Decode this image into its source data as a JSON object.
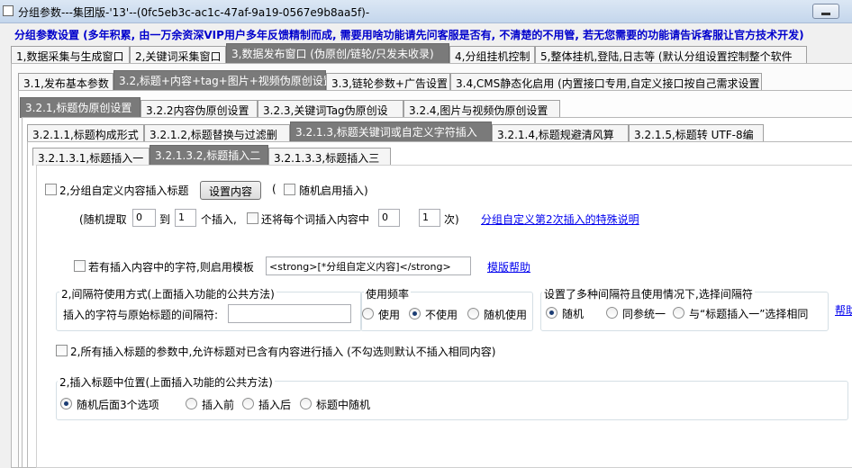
{
  "window": {
    "title": "分组参数---集团版-'13'--(0fc5eb3c-ac1c-47af-9a19-0567e9b8aa5f)-"
  },
  "notice": "分组参数设置 (多年积累, 由一万余资深VIP用户多年反馈精制而成, 需要用啥功能请先问客服是否有, 不清楚的不用管, 若无您需要的功能请告诉客服让官方技术开发)",
  "tabs_l1": [
    "1,数据采集与生成窗口",
    "2,关键词采集窗口",
    "3,数据发布窗口 (伪原创/链轮/只发未收录)",
    "4,分组挂机控制",
    "5,整体挂机,登陆,日志等 (默认分组设置控制整个软件"
  ],
  "tabs_l2": [
    "3.1,发布基本参数",
    "3.2,标题+内容+tag+图片+视频伪原创设置",
    "3.3,链轮参数+广告设置",
    "3.4,CMS静态化启用 (内置接口专用,自定义接口按自己需求设置"
  ],
  "tabs_l3": [
    "3.2.1,标题伪原创设置",
    "3.2.2内容伪原创设置",
    "3.2.3,关键词Tag伪原创设",
    "3.2.4,图片与视频伪原创设置"
  ],
  "tabs_l4": [
    "3.2.1.1,标题构成形式",
    "3.2.1.2,标题替换与过滤删",
    "3.2.1.3,标题关键词或自定义字符插入",
    "3.2.1.4,标题规避清风算",
    "3.2.1.5,标题转 UTF-8编"
  ],
  "tabs_l5": [
    "3.2.1.3.1,标题插入一",
    "3.2.1.3.2,标题插入二",
    "3.2.1.3.3,标题插入三"
  ],
  "row1": {
    "checkbox_label": "2,分组自定义内容插入标题",
    "setup_button": "设置内容",
    "paren_open": "(",
    "random_enable": "随机启用插入)"
  },
  "row2": {
    "prefix": "(随机提取",
    "from_value": "0",
    "to_label": "到",
    "to_value": "1",
    "count_label": "个插入,",
    "also_label": "还将每个词插入内容中",
    "content_value1": "0",
    "content_value2": "1",
    "suffix": "次)",
    "link": "分组自定义第2次插入的特殊说明"
  },
  "row3": {
    "checkbox_label": "若有插入内容中的字符,则启用模板",
    "template_value": "<strong>[*分组自定义内容]</strong>",
    "link": "模版帮助"
  },
  "separator_group": {
    "title": "2,间隔符使用方式(上面插入功能的公共方法)",
    "label": "插入的字符与原始标题的间隔符:",
    "value": ""
  },
  "frequency_group": {
    "title": "使用频率",
    "options": [
      "使用",
      "不使用",
      "随机使用"
    ],
    "selected": 1
  },
  "multi_group": {
    "title": "设置了多种间隔符且使用情况下,选择间隔符",
    "options": [
      "随机",
      "同参统一",
      "与“标题插入一”选择相同"
    ],
    "selected": 0,
    "help": "帮助"
  },
  "row5": {
    "checkbox_label": "2,所有插入标题的参数中,允许标题对已含有内容进行插入 (不勾选则默认不插入相同内容)"
  },
  "position_group": {
    "title": "2,插入标题中位置(上面插入功能的公共方法)",
    "options": [
      "随机后面3个选项",
      "插入前",
      "插入后",
      "标题中随机"
    ],
    "selected": 0
  }
}
